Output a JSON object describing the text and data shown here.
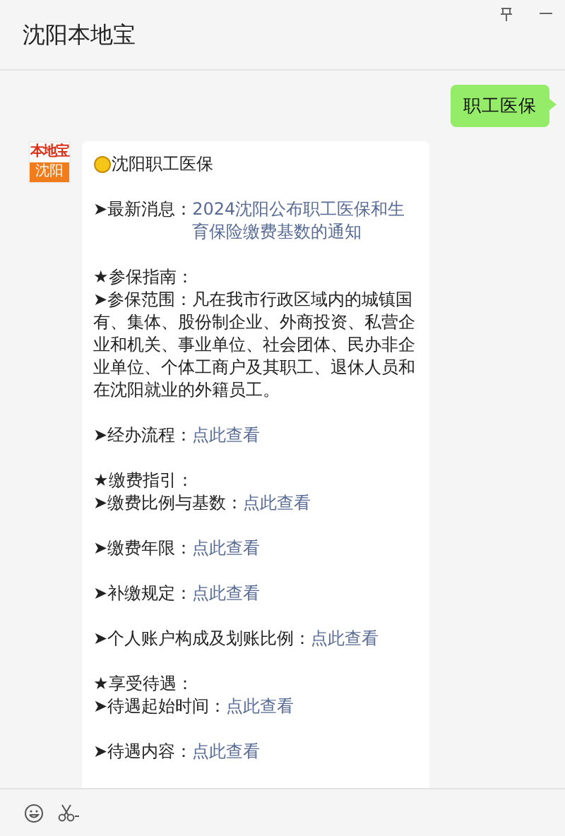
{
  "window": {
    "title": "沈阳本地宝"
  },
  "sent_message": {
    "text": "职工医保"
  },
  "avatar": {
    "top_text": "本地宝",
    "bottom_text": "沈阳"
  },
  "reply": {
    "title": "沈阳职工医保",
    "groups": [
      [
        {
          "text": "➤最新消息：",
          "link": "2024沈阳公布职工医保和生育保险缴费基数的通知"
        }
      ],
      [
        {
          "text": "★参保指南："
        },
        {
          "text": "➤参保范围：凡在我市行政区域内的城镇国有、集体、股份制企业、外商投资、私营企业和机关、事业单位、社会团体、民办非企业单位、个体工商户及其职工、退休人员和在沈阳就业的外籍员工。"
        }
      ],
      [
        {
          "text": "➤经办流程：",
          "link": "点此查看"
        }
      ],
      [
        {
          "text": "★缴费指引："
        },
        {
          "text": "➤缴费比例与基数：",
          "link": "点此查看"
        }
      ],
      [
        {
          "text": "➤缴费年限：",
          "link": "点此查看"
        }
      ],
      [
        {
          "text": "➤补缴规定：",
          "link": "点此查看"
        }
      ],
      [
        {
          "text": "➤个人账户构成及划账比例：",
          "link": "点此查看"
        }
      ],
      [
        {
          "text": "★享受待遇："
        },
        {
          "text": "➤待遇起始时间：",
          "link": "点此查看"
        }
      ],
      [
        {
          "text": "➤待遇内容：",
          "link": "点此查看"
        }
      ]
    ]
  }
}
